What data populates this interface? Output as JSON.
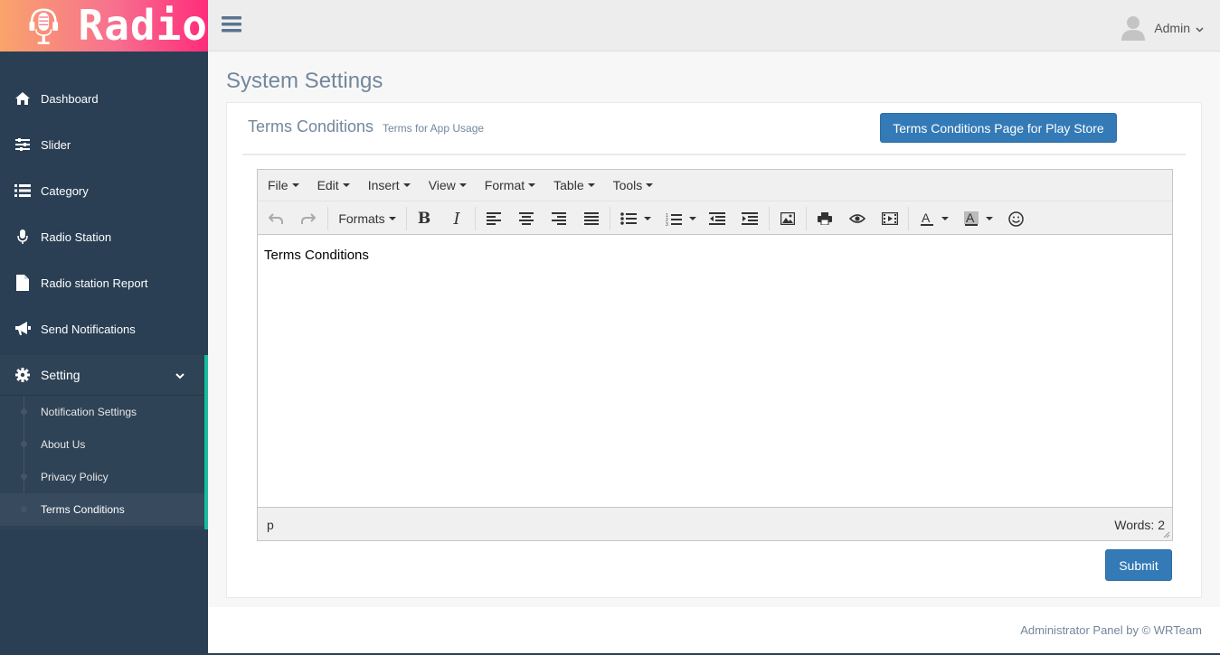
{
  "brand": {
    "logo_text": "Radio",
    "logo_icon": "microphone-icon"
  },
  "sidebar": {
    "items": [
      {
        "label": "Dashboard",
        "icon": "home-icon"
      },
      {
        "label": "Slider",
        "icon": "sliders-icon"
      },
      {
        "label": "Category",
        "icon": "list-icon"
      },
      {
        "label": "Radio Station",
        "icon": "microphone-icon"
      },
      {
        "label": "Radio station Report",
        "icon": "file-icon"
      },
      {
        "label": "Send Notifications",
        "icon": "bullhorn-icon"
      }
    ],
    "setting": {
      "label": "Setting",
      "icon": "gear-icon",
      "subitems": [
        "Notification Settings",
        "About Us",
        "Privacy Policy",
        "Terms Conditions"
      ],
      "active_subitem": "Terms Conditions"
    }
  },
  "topbar": {
    "user_name": "Admin"
  },
  "page": {
    "title": "System Settings"
  },
  "panel": {
    "title": "Terms Conditions",
    "subtitle": "Terms for App Usage",
    "playstore_button": "Terms Conditions Page for Play Store",
    "submit_button": "Submit"
  },
  "editor": {
    "menus": [
      "File",
      "Edit",
      "Insert",
      "View",
      "Format",
      "Table",
      "Tools"
    ],
    "formats_label": "Formats",
    "content": "Terms Conditions",
    "path": "p",
    "word_count": "Words: 2"
  },
  "footer": {
    "text": "Administrator Panel by © WRTeam"
  },
  "colors": {
    "sidebar": "#2a3f54",
    "accent": "#1abb9c",
    "primary_button": "#337ab7",
    "title_text": "#73879c"
  }
}
